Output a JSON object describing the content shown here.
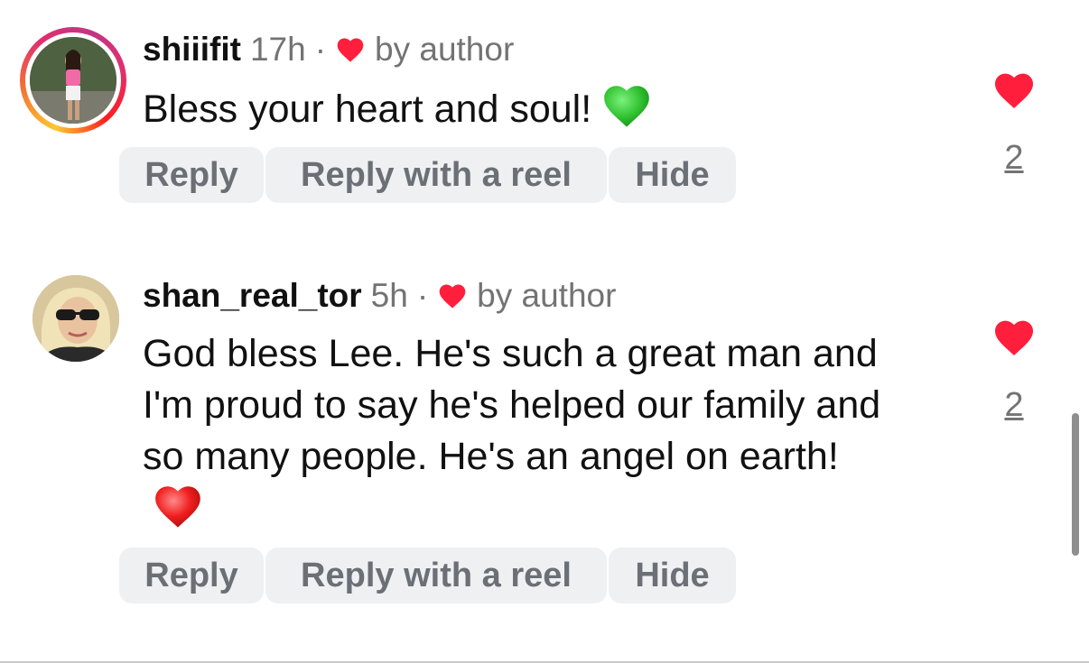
{
  "colors": {
    "like_red": "#ff1e3c",
    "meta_gray": "#737373",
    "button_bg": "#eff0f2",
    "button_text": "#6b6f76"
  },
  "comments": [
    {
      "username": "shiiifit",
      "time": "17h",
      "separator": "·",
      "liked_by": "by author",
      "text": "Bless your heart and soul!",
      "emoji_icon": "green-heart-icon",
      "actions": [
        "Reply",
        "Reply with a reel",
        "Hide"
      ],
      "like_count": "2",
      "has_story_ring": true
    },
    {
      "username": "shan_real_tor",
      "time": "5h",
      "separator": "·",
      "liked_by": "by author",
      "text": "God bless Lee. He's such a great man and I'm proud to say he's helped our family and so many people. He's an angel on earth!",
      "emoji_icon": "red-heart-icon",
      "actions": [
        "Reply",
        "Reply with a reel",
        "Hide"
      ],
      "like_count": "2",
      "has_story_ring": false
    }
  ]
}
